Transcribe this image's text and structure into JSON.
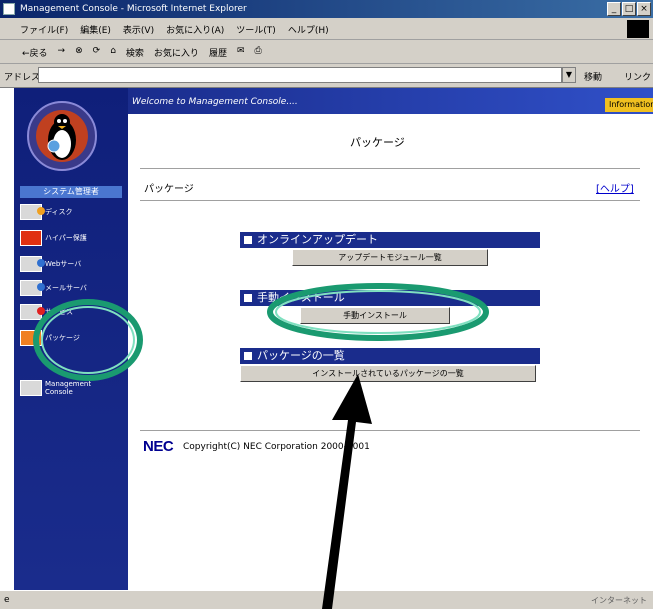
{
  "window": {
    "title": "Management Console - Microsoft Internet Explorer",
    "buttons": [
      "_",
      "□",
      "×"
    ]
  },
  "menubar": {
    "items": [
      "ファイル(F)",
      "編集(E)",
      "表示(V)",
      "お気に入り(A)",
      "ツール(T)",
      "ヘルプ(H)"
    ]
  },
  "toolbar": {
    "back": "←戻る",
    "forward": "→",
    "search": "検索",
    "favorites": "お気に入り",
    "history": "履歴"
  },
  "addressbar": {
    "label": "アドレス(D)",
    "value": "",
    "go": "移動",
    "links": "リンク"
  },
  "leftnav": {
    "header": "システム管理者",
    "items": [
      {
        "label": "ディスク"
      },
      {
        "label": "ハイパー保護"
      },
      {
        "label": "Webサーバ"
      },
      {
        "label": "メールサーバ"
      },
      {
        "label": "サービス"
      },
      {
        "label": "パッケージ"
      },
      {
        "label": "Management Console"
      }
    ]
  },
  "content": {
    "welcome": "Welcome to Management Console....",
    "info_tab": "Information",
    "heading": "パッケージ",
    "section_label": "パッケージ",
    "help_link": "[ヘルプ]",
    "groups": [
      {
        "title": "オンラインアップデート",
        "button": "アップデートモジュール一覧"
      },
      {
        "title": "手動インストール",
        "button": "手動インストール"
      },
      {
        "title": "パッケージの一覧",
        "button": "インストールされているパッケージの一覧"
      }
    ],
    "nec_logo": "NEC",
    "copyright": "Copyright(C) NEC Corporation 2000-2001"
  },
  "statusbar": {
    "zone": "インターネット"
  },
  "colors": {
    "nav_blue": "#1a2c8c",
    "highlight_green": "#1a9a70",
    "arrow": "#000000"
  }
}
